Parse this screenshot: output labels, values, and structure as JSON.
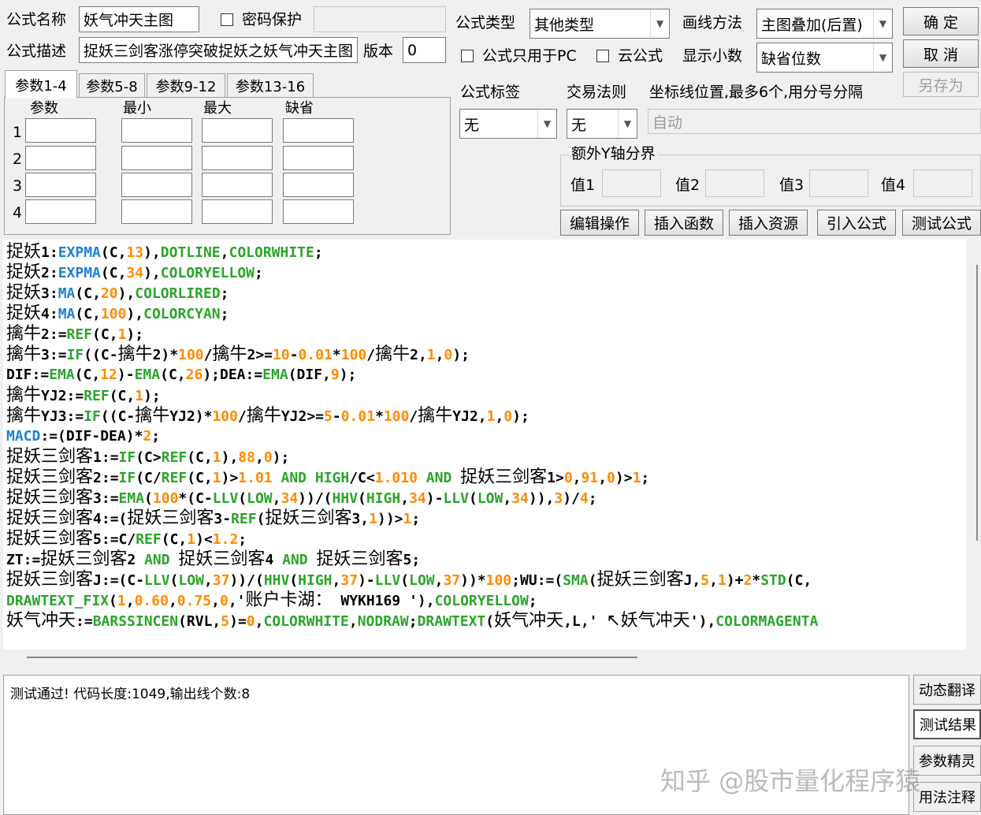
{
  "header": {
    "formula_name_label": "公式名称",
    "formula_name_value": "妖气冲天主图",
    "password_label": "密码保护",
    "formula_desc_label": "公式描述",
    "formula_desc_value": "捉妖三剑客涨停突破捉妖之妖气冲天主图",
    "version_label": "版本",
    "version_value": "0",
    "formula_type_label": "公式类型",
    "formula_type_value": "其他类型",
    "draw_method_label": "画线方法",
    "draw_method_value": "主图叠加(后置)",
    "pc_only_label": "公式只用于PC",
    "cloud_label": "云公式",
    "decimals_label": "显示小数",
    "decimals_value": "缺省位数"
  },
  "buttons": {
    "ok": "确  定",
    "cancel": "取  消",
    "save_as": "另存为",
    "edit_ops": "编辑操作",
    "insert_func": "插入函数",
    "insert_res": "插入资源",
    "import_formula": "引入公式",
    "test_formula": "测试公式"
  },
  "tabs": [
    "参数1-4",
    "参数5-8",
    "参数9-12",
    "参数13-16"
  ],
  "param_table": {
    "headers": [
      "参数",
      "最小",
      "最大",
      "缺省"
    ],
    "rows": [
      "1",
      "2",
      "3",
      "4"
    ]
  },
  "tag": {
    "label": "公式标签",
    "value": "无"
  },
  "trade_rule": {
    "label": "交易法则",
    "value": "无"
  },
  "coord": {
    "label": "坐标线位置,最多6个,用分号分隔",
    "value": "自动"
  },
  "extra_y": {
    "label": "额外Y轴分界",
    "v1": "值1",
    "v2": "值2",
    "v3": "值3",
    "v4": "值4"
  },
  "output": {
    "message": "测试通过! 代码长度:1049,输出线个数:8"
  },
  "side_buttons": [
    "动态翻译",
    "测试结果",
    "参数精灵",
    "用法注释"
  ],
  "watermark": "知乎 @股市量化程序猿",
  "colors": {
    "keyword_green": "#2aa52a",
    "number_orange": "#ff8a00",
    "func_blue": "#1e7fd4"
  }
}
